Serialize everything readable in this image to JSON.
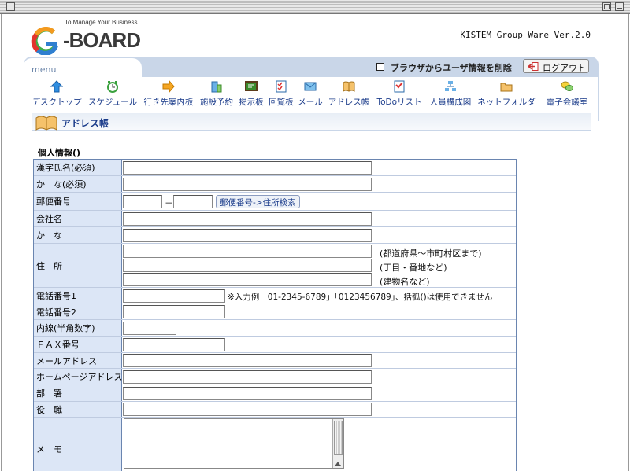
{
  "header": {
    "logo_tagline": "To Manage Your Business",
    "logo_text": "-BOARD",
    "logo_letter": "G",
    "version": "KISTEM Group Ware Ver.2.0"
  },
  "menubar": {
    "menu_label": "menu",
    "delete_info_label": "ブラウザからユーザ情報を削除",
    "logout_label": "ログアウト"
  },
  "nav": [
    {
      "label": "デスクトップ",
      "icon": "up-arrow-icon"
    },
    {
      "label": "スケジュール",
      "icon": "clock-icon"
    },
    {
      "label": "行き先案内板",
      "icon": "right-arrow-icon"
    },
    {
      "label": "施設予約",
      "icon": "building-icon"
    },
    {
      "label": "掲示板",
      "icon": "bulletin-board-icon"
    },
    {
      "label": "回覧板",
      "icon": "checklist-icon"
    },
    {
      "label": "メール",
      "icon": "mail-icon"
    },
    {
      "label": "アドレス帳",
      "icon": "address-book-icon"
    },
    {
      "label": "ToDoリスト",
      "icon": "todo-icon"
    },
    {
      "label": "人員構成図",
      "icon": "org-chart-icon"
    },
    {
      "label": "ネットフォルダ",
      "icon": "folder-icon"
    },
    {
      "label": "電子会議室",
      "icon": "meeting-icon"
    }
  ],
  "page": {
    "title": "アドレス帳",
    "section_title": "個人情報()"
  },
  "form": {
    "kanji_name": "漢字氏名(必須)",
    "kana_required": "か　な(必須)",
    "postal_code": "郵便番号",
    "postal_dash": "－",
    "postal_search_button": "郵便番号->住所検索",
    "company_name": "会社名",
    "company_kana": "か　な",
    "address": "住　所",
    "address_note_1": "(都道府県～市町村区まで)",
    "address_note_2": "(丁目・番地など)",
    "address_note_3": "(建物名など)",
    "phone_1": "電話番号1",
    "phone_note": "※入力例「01-2345-6789」「0123456789」、括弧()は使用できません",
    "phone_2": "電話番号2",
    "extension": "内線(半角数字)",
    "fax": "ＦＡＸ番号",
    "email": "メールアドレス",
    "homepage": "ホームページアドレス",
    "department": "部　署",
    "position": "役　職",
    "memo": "メ　モ"
  },
  "colors": {
    "accent_blue": "#1a3b8a",
    "label_bg": "#dce6f6",
    "menubar_bg": "#c9d6e8"
  }
}
